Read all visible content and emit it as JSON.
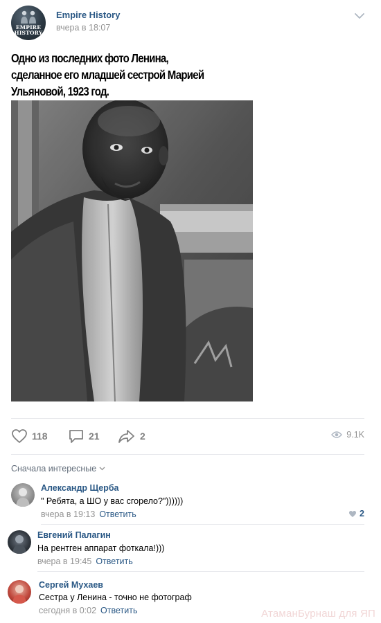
{
  "post": {
    "group_name": "Empire History",
    "time": "вчера в 18:07",
    "avatar_text": "EMPIRE\nHISTORY",
    "text": "Одно из последних фото Ленина,\nсделанное его младшей сестрой Марией\nУльяновой, 1923 год."
  },
  "actions": {
    "likes": "118",
    "comments": "21",
    "shares": "2",
    "views": "9.1K",
    "icons": {
      "like": "heart-icon",
      "comment": "comment-icon",
      "share": "share-icon",
      "views": "eye-icon"
    }
  },
  "comments": {
    "sort_label": "Сначала интересные",
    "reply_label": "Ответить",
    "items": [
      {
        "author": "Александр Щерба",
        "text": "\" Ребята, а ШО у вас сгорело?\"))))))",
        "time": "вчера в 19:13",
        "likes": "2"
      },
      {
        "author": "Евгений Палагин",
        "text": "На рентген аппарат фоткала!)))",
        "time": "вчера в 19:45"
      },
      {
        "author": "Сергей Мухаев",
        "text": "Сестра у Ленина - точно не фотограф",
        "time": "сегодня в 0:02"
      }
    ]
  },
  "watermark": "АтаманБурнаш для ЯП",
  "colors": {
    "link": "#2a5885",
    "muted": "#939393",
    "separator": "#e7e8ec",
    "icon": "#828282"
  }
}
